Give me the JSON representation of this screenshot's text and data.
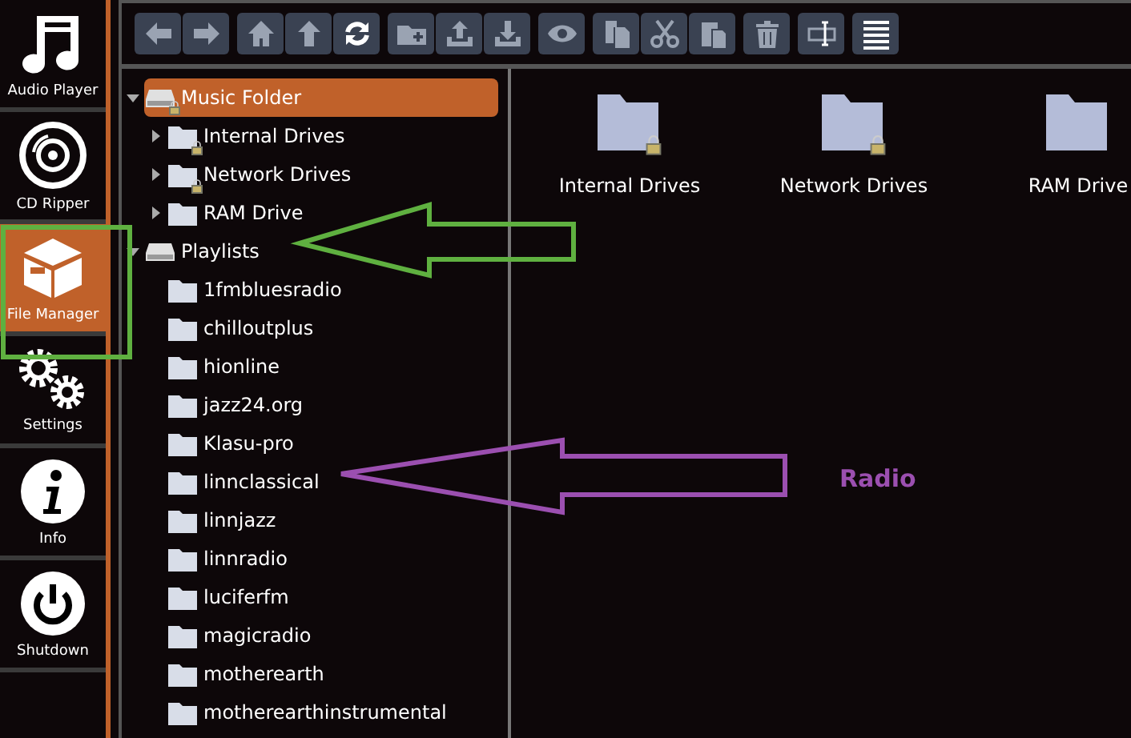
{
  "sidebar": {
    "items": [
      {
        "label": "Audio Player",
        "kind": "note",
        "selected": false
      },
      {
        "label": "CD Ripper",
        "kind": "disc",
        "selected": false
      },
      {
        "label": "File Manager",
        "kind": "box",
        "selected": true
      },
      {
        "label": "Settings",
        "kind": "gears",
        "selected": false
      },
      {
        "label": "Info",
        "kind": "info",
        "selected": false
      },
      {
        "label": "Shutdown",
        "kind": "power",
        "selected": false
      }
    ]
  },
  "toolbar": {
    "groups": [
      [
        {
          "kind": "back"
        },
        {
          "kind": "forward"
        }
      ],
      [
        {
          "kind": "home"
        },
        {
          "kind": "up"
        },
        {
          "kind": "refresh"
        }
      ],
      [
        {
          "kind": "new-folder"
        },
        {
          "kind": "upload"
        },
        {
          "kind": "download"
        }
      ],
      [
        {
          "kind": "view"
        }
      ],
      [
        {
          "kind": "copy"
        },
        {
          "kind": "cut"
        },
        {
          "kind": "paste"
        }
      ],
      [
        {
          "kind": "delete"
        }
      ],
      [
        {
          "kind": "rename"
        }
      ],
      [
        {
          "kind": "list"
        }
      ]
    ]
  },
  "tree": [
    {
      "label": "Music Folder",
      "kind": "drive",
      "locked": true,
      "expanded": true,
      "selected": true,
      "children": [
        {
          "label": "Internal Drives",
          "kind": "folder",
          "locked": true,
          "expanded": false,
          "selected": false
        },
        {
          "label": "Network Drives",
          "kind": "folder",
          "locked": true,
          "expanded": false,
          "selected": false
        },
        {
          "label": "RAM Drive",
          "kind": "folder",
          "locked": false,
          "expanded": false,
          "selected": false
        }
      ]
    },
    {
      "label": "Playlists",
      "kind": "drive",
      "locked": false,
      "expanded": true,
      "selected": false,
      "children": [
        {
          "label": "1fmbluesradio",
          "kind": "folder",
          "locked": false,
          "selected": false
        },
        {
          "label": "chilloutplus",
          "kind": "folder",
          "locked": false,
          "selected": false
        },
        {
          "label": "hionline",
          "kind": "folder",
          "locked": false,
          "selected": false
        },
        {
          "label": "jazz24.org",
          "kind": "folder",
          "locked": false,
          "selected": false
        },
        {
          "label": "Klasu-pro",
          "kind": "folder",
          "locked": false,
          "selected": false
        },
        {
          "label": "linnclassical",
          "kind": "folder",
          "locked": false,
          "selected": false
        },
        {
          "label": "linnjazz",
          "kind": "folder",
          "locked": false,
          "selected": false
        },
        {
          "label": "linnradio",
          "kind": "folder",
          "locked": false,
          "selected": false
        },
        {
          "label": "luciferfm",
          "kind": "folder",
          "locked": false,
          "selected": false
        },
        {
          "label": "magicradio",
          "kind": "folder",
          "locked": false,
          "selected": false
        },
        {
          "label": "motherearth",
          "kind": "folder",
          "locked": false,
          "selected": false
        },
        {
          "label": "motherearthinstrumental",
          "kind": "folder",
          "locked": false,
          "selected": false
        }
      ]
    }
  ],
  "files": [
    {
      "label": "Internal Drives",
      "locked": true
    },
    {
      "label": "Network Drives",
      "locked": true
    },
    {
      "label": "RAM Drive",
      "locked": false
    }
  ],
  "annotations": {
    "radio_label": "Radio"
  }
}
